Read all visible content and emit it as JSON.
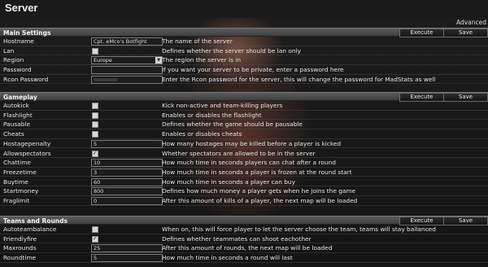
{
  "title": "Server",
  "advanced_link": "Advanced",
  "execute_label": "Execute",
  "save_label": "Save",
  "sections": [
    {
      "title": "Main Settings",
      "rows": [
        {
          "name": "Hostname",
          "type": "text",
          "value": "Cpt. eMco's Botfight",
          "desc": "The name of the server"
        },
        {
          "name": "Lan",
          "type": "checkbox",
          "checked": false,
          "desc": "Defines whether the server should be lan only"
        },
        {
          "name": "Region",
          "type": "select",
          "value": "Europe",
          "desc": "The region the server is in"
        },
        {
          "name": "Password",
          "type": "text",
          "value": "",
          "desc": "If you want your server to be private, enter a password here"
        },
        {
          "name": "Rcon Password",
          "type": "password",
          "value": "",
          "desc": "Enter the Rcon password for the server, this will change the password for MadStats as well"
        }
      ]
    },
    {
      "title": "Gameplay",
      "rows": [
        {
          "name": "Autokick",
          "type": "checkbox",
          "checked": false,
          "desc": "Kick non-active and team-killing players"
        },
        {
          "name": "Flashlight",
          "type": "checkbox",
          "checked": false,
          "desc": "Enables or disables the flashlight"
        },
        {
          "name": "Pausable",
          "type": "checkbox",
          "checked": false,
          "desc": "Defines whether the game should be pausable"
        },
        {
          "name": "Cheats",
          "type": "checkbox",
          "checked": false,
          "desc": "Enables or disables cheats"
        },
        {
          "name": "Hostagepenalty",
          "type": "text",
          "value": "5",
          "desc": "How many hostages may be killed before a player is kicked"
        },
        {
          "name": "Allowspectators",
          "type": "checkbox",
          "checked": true,
          "desc": "Whether spectators are allowed to be in the server"
        },
        {
          "name": "Chattime",
          "type": "text",
          "value": "10",
          "desc": "How much time in seconds players can chat after a round"
        },
        {
          "name": "Freezetime",
          "type": "text",
          "value": "3",
          "desc": "How much time in seconds a player is frozen at the round start"
        },
        {
          "name": "Buytime",
          "type": "text",
          "value": "60",
          "desc": "How much time in seconds a player can buy"
        },
        {
          "name": "Startmoney",
          "type": "text",
          "value": "800",
          "desc": "Defines how much money a player gets when he joins the game"
        },
        {
          "name": "Fraglimit",
          "type": "text",
          "value": "0",
          "desc": "After this amount of kills of a player, the next map will be loaded"
        }
      ]
    },
    {
      "title": "Teams and Rounds",
      "rows": [
        {
          "name": "Autoteambalance",
          "type": "checkbox",
          "checked": false,
          "desc": "When on, this will force player to let the server choose the team, teams will stay ballanced"
        },
        {
          "name": "Friendlyfire",
          "type": "checkbox",
          "checked": true,
          "desc": "Defines whether teammates can shoot eachother"
        },
        {
          "name": "Maxrounds",
          "type": "text",
          "value": "25",
          "desc": "After this amount of rounds, the next map will be loaded"
        },
        {
          "name": "Roundtime",
          "type": "text",
          "value": "5",
          "desc": "How much time in seconds a round will last"
        }
      ]
    }
  ]
}
